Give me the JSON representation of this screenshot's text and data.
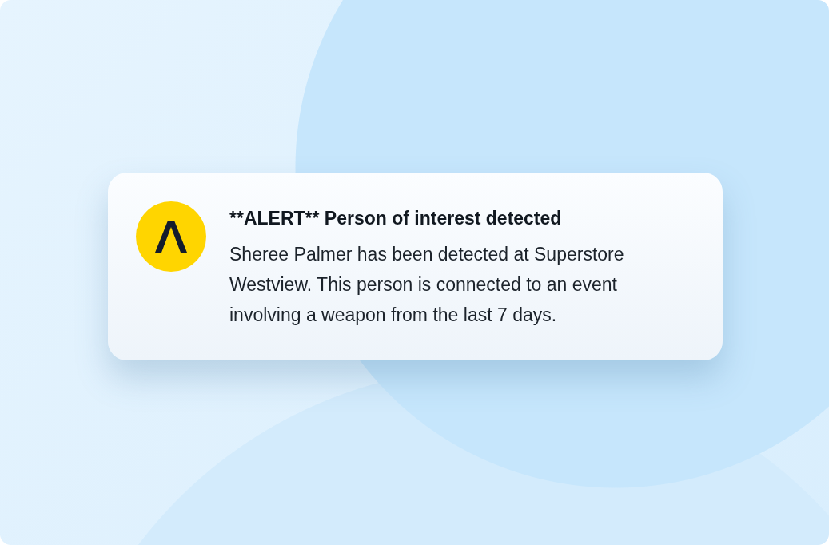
{
  "notification": {
    "title": "**ALERT** Person of interest detected",
    "message": "Sheree Palmer has been detected at Superstore Westview. This person is connected to an event involving a weapon from the last 7 days."
  }
}
